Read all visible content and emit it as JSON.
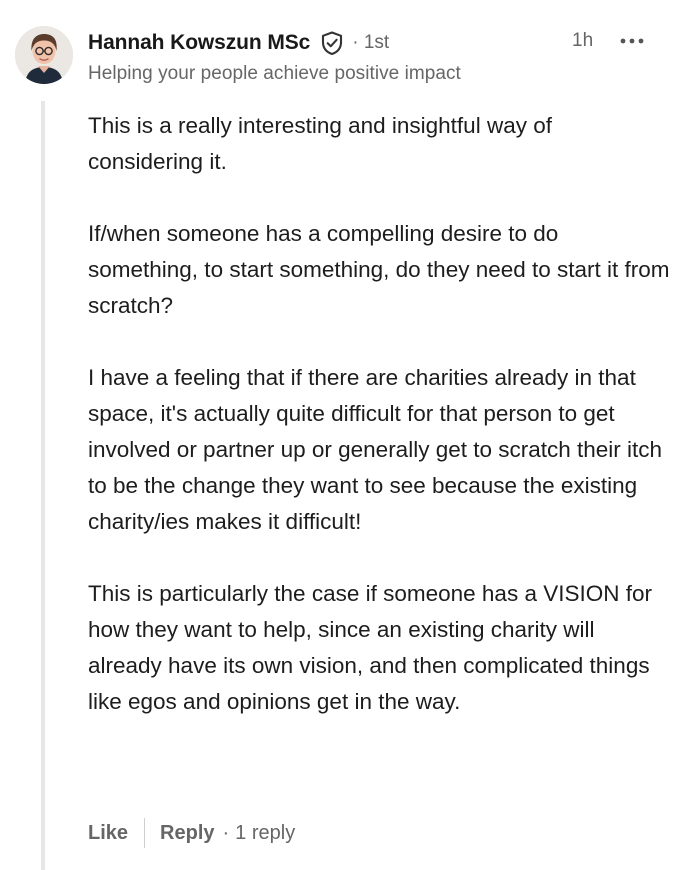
{
  "comment": {
    "author": {
      "name": "Hannah Kowszun MSc",
      "verified_icon": "shield-check-icon",
      "connection_degree": "· 1st",
      "headline": "Helping your people achieve positive impact",
      "avatar_icon": "profile-photo"
    },
    "time": "1h",
    "more_icon": "ellipsis-icon",
    "paragraphs": [
      "This is a really interesting and insightful way of considering it.",
      "If/when someone has a compelling desire to do something, to start something, do they need to start it from scratch?",
      "I have a feeling that if there are charities already in that space, it's actually quite difficult for that person to get involved or partner up or generally get to scratch their itch to be the change they want to see because the existing charity/ies makes it difficult!",
      "This is particularly the case if someone has a VISION for how they want to help, since an existing charity will already have its own vision, and then complicated things like egos and opinions get in the way."
    ],
    "actions": {
      "like_label": "Like",
      "reply_label": "Reply",
      "separator": "·",
      "reply_count": "1 reply"
    }
  },
  "colors": {
    "primary_text": "#1d1d1d",
    "secondary_text": "#666666",
    "thread_line": "#e6e6e6"
  }
}
